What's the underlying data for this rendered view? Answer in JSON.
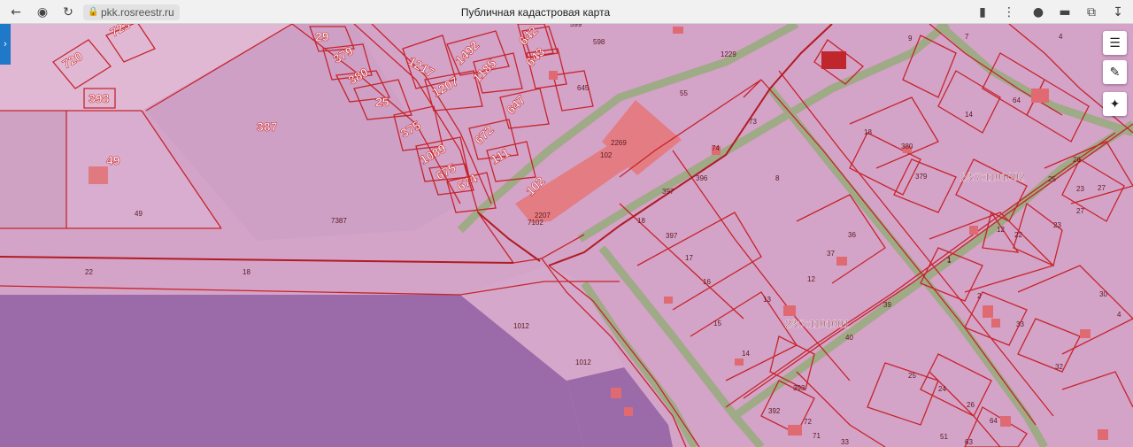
{
  "browser": {
    "url": "pkk.rosreestr.ru",
    "title": "Публичная кадастровая карта",
    "icons": [
      "back-arrow-icon",
      "yandex-icon",
      "reload-icon",
      "lock-icon",
      "bookmark-icon",
      "more-icon",
      "extension-icon",
      "incognito-icon",
      "collections-icon",
      "download-icon"
    ]
  },
  "map": {
    "quarters": [
      "23:7:1101002",
      "23:7:1101001"
    ],
    "big_labels": [
      {
        "t": "720"
      },
      {
        "t": "723"
      },
      {
        "t": "398"
      },
      {
        "t": "49"
      },
      {
        "t": "387"
      },
      {
        "t": "29"
      },
      {
        "t": "379"
      },
      {
        "t": "380"
      },
      {
        "t": "25"
      },
      {
        "t": "375"
      },
      {
        "t": "1089"
      },
      {
        "t": "675"
      },
      {
        "t": "674"
      },
      {
        "t": "1217"
      },
      {
        "t": "1492"
      },
      {
        "t": "1185"
      },
      {
        "t": "1207"
      },
      {
        "t": "647"
      },
      {
        "t": "672"
      },
      {
        "t": "111"
      },
      {
        "t": "642"
      },
      {
        "t": "643"
      },
      {
        "t": "102"
      }
    ],
    "small_labels": [
      "49",
      "7387",
      "22",
      "18",
      "2207",
      "7102",
      "102",
      "2269",
      "55",
      "1229",
      "9",
      "7",
      "4",
      "73",
      "74",
      "8",
      "396",
      "397",
      "18",
      "397",
      "17",
      "16",
      "15",
      "14",
      "13",
      "12",
      "36",
      "37",
      "39",
      "40",
      "18",
      "380",
      "379",
      "14",
      "64",
      "26",
      "25",
      "27",
      "23",
      "12",
      "22",
      "1",
      "23",
      "27",
      "30",
      "32",
      "33",
      "1012",
      "1012",
      "393",
      "392",
      "72",
      "71",
      "33",
      "25",
      "24",
      "26",
      "64",
      "51",
      "63",
      "645",
      "598",
      "599",
      "4",
      "2",
      "1"
    ],
    "toolbar": {
      "layers": "layers-icon",
      "ruler": "ruler-icon",
      "locate": "locate-icon"
    }
  }
}
